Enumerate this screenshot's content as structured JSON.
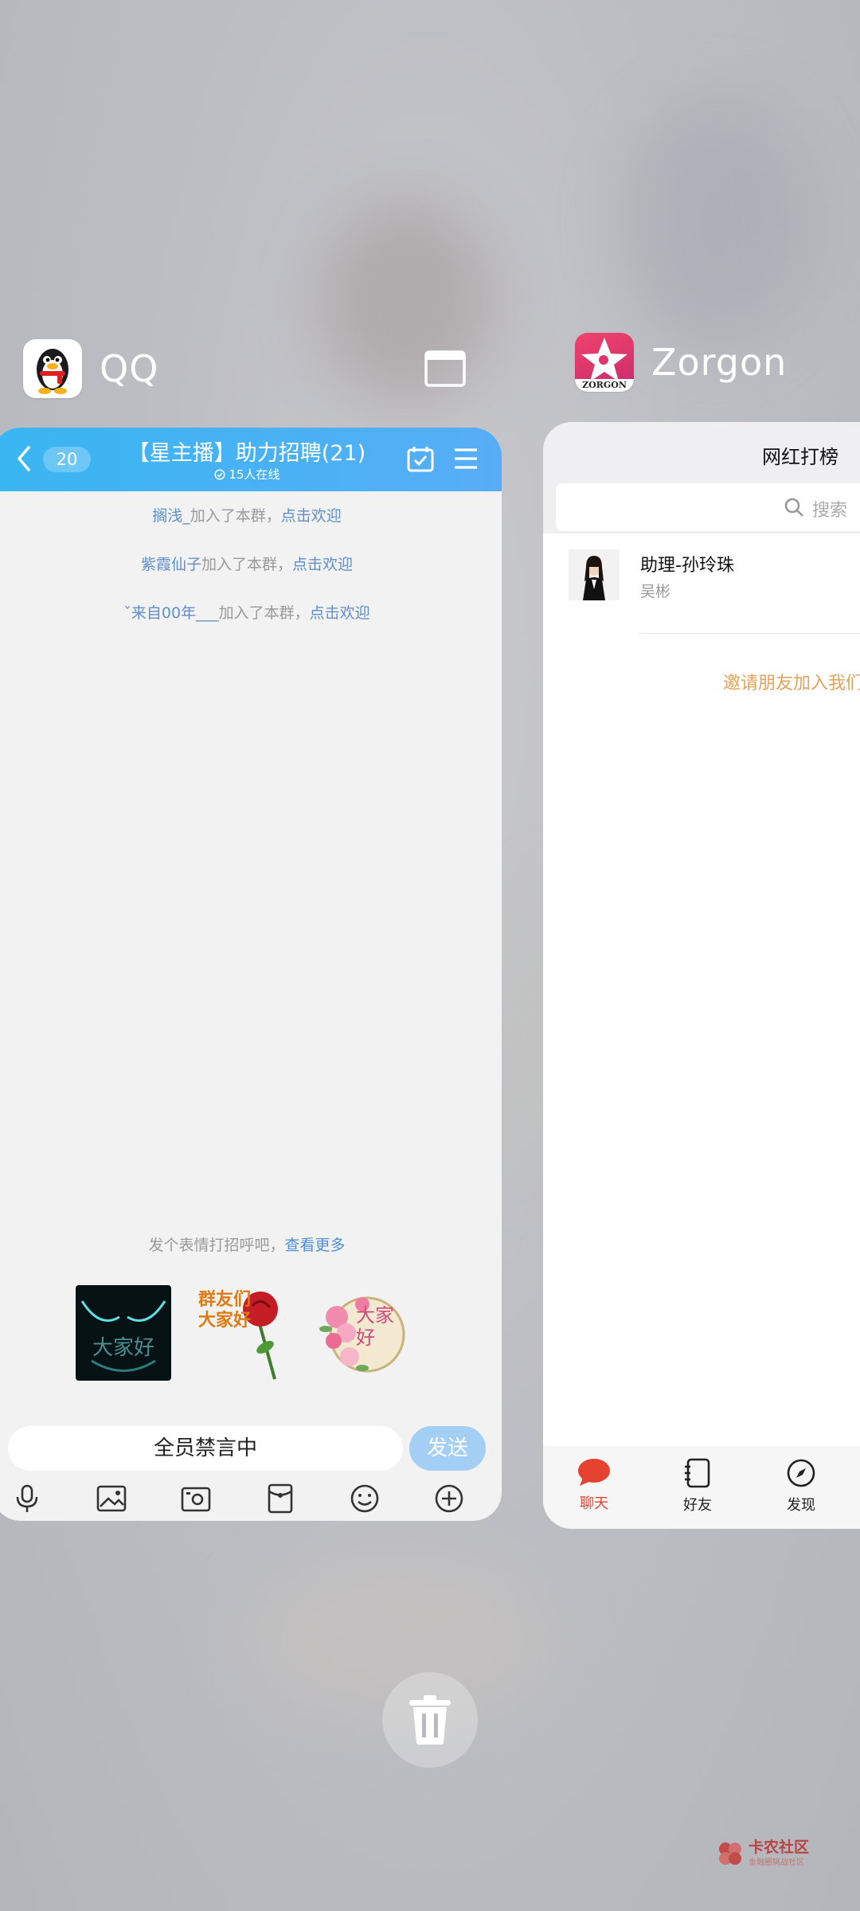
{
  "apps": {
    "qq": {
      "name": "QQ",
      "chat": {
        "unread_count": "20",
        "title": "【星主播】助力招聘(21)",
        "online": "15人在线",
        "system_messages": [
          {
            "name": "搁浅_",
            "text": "加入了本群，",
            "link": "点击欢迎"
          },
          {
            "name": "紫霞仙子",
            "text": "加入了本群，",
            "link": "点击欢迎"
          },
          {
            "name": "ˇ来自00年___",
            "text": "加入了本群，",
            "link": "点击欢迎"
          }
        ],
        "greet_hint": "发个表情打招呼吧，",
        "greet_link": "查看更多",
        "stickers": [
          {
            "text": "大家好"
          },
          {
            "text": "群友们大家好"
          },
          {
            "text": "大家好"
          }
        ],
        "input_text": "全员禁言中",
        "send_label": "发送"
      }
    },
    "zorgon": {
      "name": "Zorgon",
      "icon_text": "ZORGON",
      "title": "网红打榜",
      "search_placeholder": "搜索",
      "contacts": [
        {
          "name": "助理-孙玲珠",
          "sub": "吴彬"
        }
      ],
      "invite": "邀请朋友加入我们",
      "tabs": [
        {
          "label": "聊天",
          "active": true
        },
        {
          "label": "好友",
          "active": false
        },
        {
          "label": "发现",
          "active": false
        }
      ],
      "accent_color": "#e5432f"
    }
  },
  "watermark": {
    "title": "卡农社区",
    "subtitle": "金融圈挑战社区"
  }
}
